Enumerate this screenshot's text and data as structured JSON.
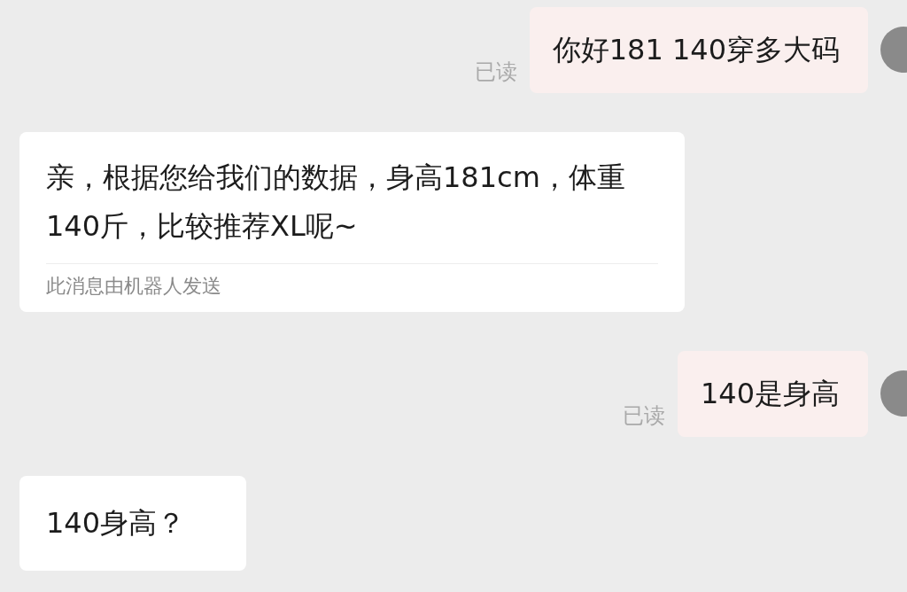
{
  "messages": [
    {
      "kind": "outgoing",
      "text": "你好181 140穿多大码",
      "receipt": "已读"
    },
    {
      "kind": "incoming",
      "text": "亲，根据您给我们的数据，身高181cm，体重140斤，比较推荐XL呢~",
      "footer": "此消息由机器人发送"
    },
    {
      "kind": "outgoing",
      "text": "140是身高",
      "receipt": "已读"
    },
    {
      "kind": "incoming",
      "text": "140身高？"
    }
  ]
}
